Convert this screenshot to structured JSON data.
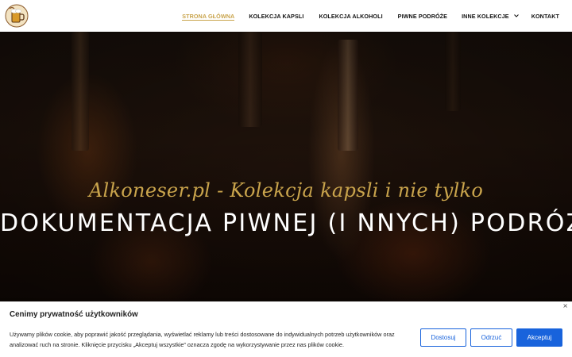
{
  "header": {
    "logo_icon": "beer-mug-logo-icon",
    "nav": [
      {
        "label": "STRONA GŁÓWNA",
        "active": true
      },
      {
        "label": "KOLEKCJA KAPSLI"
      },
      {
        "label": "KOLEKCJA ALKOHOLI"
      },
      {
        "label": "PIWNE PODRÓŻE"
      },
      {
        "label": "INNE KOLEKCJE",
        "has_dropdown": true
      },
      {
        "label": "KONTAKT"
      }
    ],
    "accent_color": "#c9a44c"
  },
  "hero": {
    "subtitle": "Alkoneser.pl - Kolekcja kapsli i nie tylko",
    "title": "DOKUMENTACJA PIWNEJ (I NNYCH) PODRÓŻY"
  },
  "cookie": {
    "title": "Cenimy prywatność użytkowników",
    "text": "Używamy plików cookie, aby poprawić jakość przeglądania, wyświetlać reklamy lub treści dostosowane do indywidualnych potrzeb użytkowników oraz analizować ruch na stronie. Kliknięcie przycisku „Akceptuj wszystkie” oznacza zgodę na wykorzystywanie przez nas plików cookie.",
    "close_label": "×",
    "buttons": {
      "customize": "Dostosuj",
      "reject": "Odrzuć",
      "accept": "Akceptuj"
    },
    "button_color": "#1863dc"
  }
}
